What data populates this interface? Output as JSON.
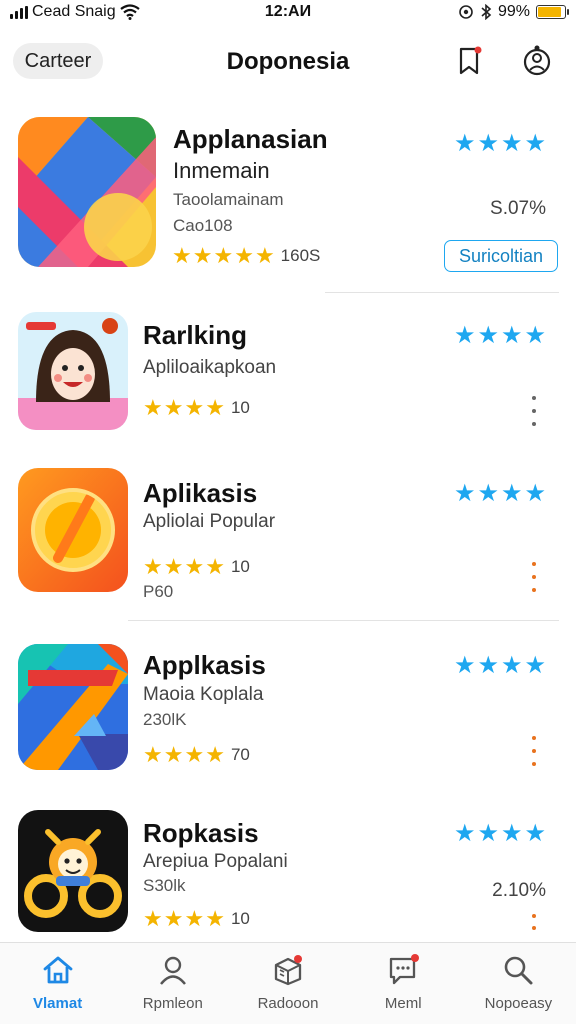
{
  "status_bar": {
    "carrier": "Cead Snaig",
    "time": "12:AИ",
    "battery_text": "99%",
    "battery_level": 0.9
  },
  "header": {
    "cancel_label": "Carteer",
    "title": "Doponesia"
  },
  "apps": [
    {
      "name": "Applanasian",
      "line1": "Inmemain",
      "line2": "Taoolamainam",
      "line3": "Cao108",
      "rating_count": "160S",
      "percent": "S.07%",
      "action_label": "Suricoltian"
    },
    {
      "name": "Rarlking",
      "line1": "Apliloaikapkoan",
      "rating_count": "10"
    },
    {
      "name": "Aplikasis",
      "line1": "Apliolai Popular",
      "rating_count": "10",
      "line2": "P60"
    },
    {
      "name": "Applkasis",
      "line1": "Maoia Koplala",
      "line2": "230lK",
      "rating_count": "70"
    },
    {
      "name": "Ropkasis",
      "line1": "Arepiua Popalani",
      "line2": "S30lk",
      "rating_count": "10",
      "percent": "2.10%"
    }
  ],
  "tabs": [
    {
      "label": "Vlamat",
      "icon": "home-icon",
      "active": true
    },
    {
      "label": "Rpmleon",
      "icon": "person-icon"
    },
    {
      "label": "Radooon",
      "icon": "gift-icon"
    },
    {
      "label": "Meml",
      "icon": "message-icon"
    },
    {
      "label": "Nopoeasy",
      "icon": "search-icon"
    }
  ],
  "colors": {
    "accent": "#1e88e5",
    "star_gold": "#f4b400",
    "star_blue": "#1ea7f0",
    "badge_red": "#e53935"
  }
}
